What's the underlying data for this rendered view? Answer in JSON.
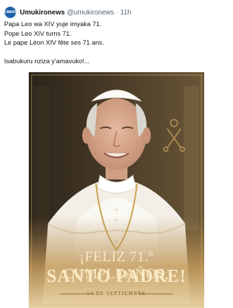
{
  "tweet": {
    "avatar_text": "UMUKI",
    "display_name": "Umukironews",
    "handle_time": "@umukironews · 11h",
    "lines": [
      "Papa Leo wa XIV yuje imyaka 71.",
      "Pope Leo XIV turns 71.",
      "Le pape Léon XIV fête ses 71 ans."
    ],
    "closing": "Isabukuru nziza y'amavuko!..."
  },
  "image": {
    "greeting": "¡FELIZ 71.º CUMPLEAÑOS,",
    "title": "SANTO PADRE!",
    "date": "14 DE SEPTIEMBRE"
  },
  "colors": {
    "text": "#0f1419",
    "muted": "#536471",
    "gold": "#d4b06a"
  }
}
